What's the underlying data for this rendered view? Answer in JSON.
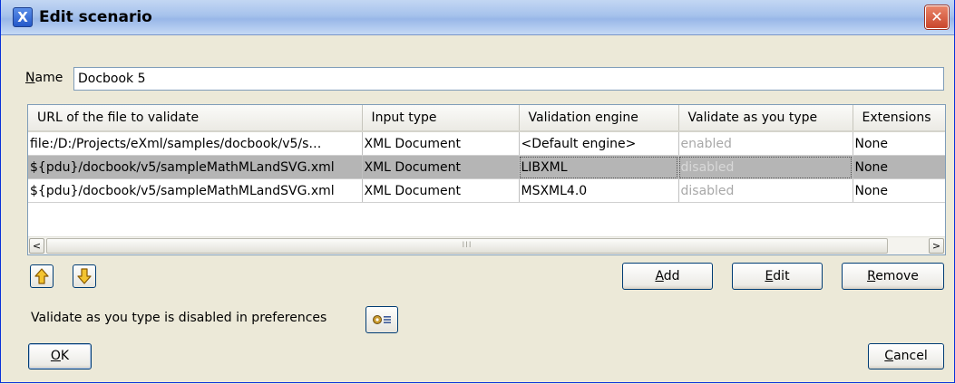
{
  "window": {
    "title": "Edit scenario",
    "app_icon": "X",
    "close_glyph": "✕"
  },
  "name_field": {
    "label_mnemonic": "N",
    "label_rest": "ame",
    "value": "Docbook 5"
  },
  "table": {
    "columns": [
      "URL of the file to validate",
      "Input type",
      "Validation engine",
      "Validate as you type",
      "Extensions"
    ],
    "rows": [
      {
        "url": "file:/D:/Projects/eXml/samples/docbook/v5/s…",
        "input_type": "XML Document",
        "engine": "<Default engine>",
        "validate": "enabled",
        "extensions": "None"
      },
      {
        "url": "${pdu}/docbook/v5/sampleMathMLandSVG.xml",
        "input_type": "XML Document",
        "engine": "LIBXML",
        "validate": "disabled",
        "extensions": "None"
      },
      {
        "url": "${pdu}/docbook/v5/sampleMathMLandSVG.xml",
        "input_type": "XML Document",
        "engine": "MSXML4.0",
        "validate": "disabled",
        "extensions": "None"
      }
    ],
    "selected_row": 1,
    "scroll_grip": "III",
    "scroll_left": "<",
    "scroll_right": ">"
  },
  "icons": {
    "move_up": "arrow-up-icon",
    "move_down": "arrow-down-icon",
    "preferences": "preferences-icon"
  },
  "buttons": {
    "add_mnemonic": "A",
    "add_rest": "dd",
    "edit_mnemonic": "E",
    "edit_rest": "dit",
    "remove_mnemonic": "R",
    "remove_rest": "emove",
    "ok_mnemonic": "O",
    "ok_rest": "K",
    "cancel_mnemonic": "C",
    "cancel_rest": "ancel"
  },
  "preferences_note": "Validate as you type is disabled in preferences",
  "colors": {
    "title_bar": "#a6c2ec",
    "dialog_bg": "#ece9d8",
    "selected_row": "#b5b5b5",
    "disabled_text": "#a8a8a8",
    "arrow_fill": "#f3c430"
  }
}
